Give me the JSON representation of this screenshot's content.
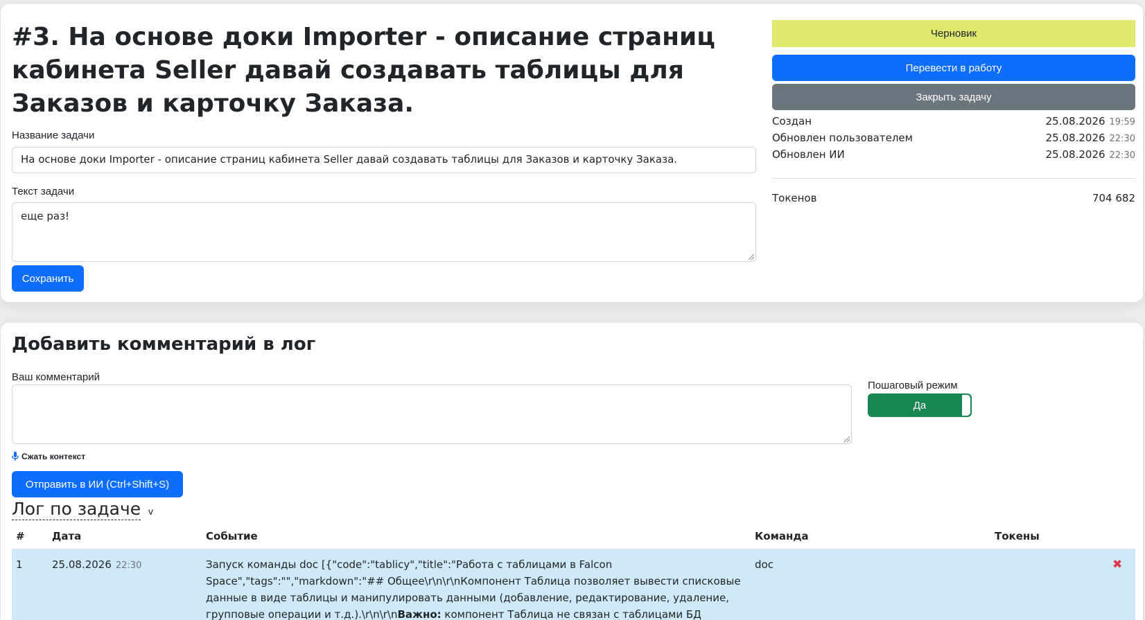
{
  "task": {
    "heading": "#3. На основе доки Importer - описание страниц кабинета Seller давай создавать таблицы для Заказов и карточку Заказа.",
    "name_label": "Название задачи",
    "name_value": "На основе доки Importer - описание страниц кабинета Seller давай создавать таблицы для Заказов и карточку Заказа.",
    "text_label": "Текст задачи",
    "text_value": "еще раз!",
    "save_label": "Сохранить"
  },
  "sidebar": {
    "status": "Черновик",
    "to_work_label": "Перевести в работу",
    "close_label": "Закрыть задачу",
    "created_label": "Создан",
    "created_date": "25.08.2026",
    "created_time": "19:59",
    "updated_user_label": "Обновлен пользователем",
    "updated_user_date": "25.08.2026",
    "updated_user_time": "22:30",
    "updated_ai_label": "Обновлен ИИ",
    "updated_ai_date": "25.08.2026",
    "updated_ai_time": "22:30",
    "tokens_label": "Токенов",
    "tokens_value": "704 682"
  },
  "comment": {
    "title": "Добавить комментарий в лог",
    "comment_label": "Ваш комментарий",
    "comment_value": "",
    "step_mode_label": "Пошаговый режим",
    "step_mode_value": "Да",
    "compress_label": "Сжать контекст",
    "send_label": "Отправить в ИИ (Ctrl+Shift+S)"
  },
  "log": {
    "title": "Лог по задаче",
    "caret": "v",
    "columns": [
      "#",
      "Дата",
      "Событие",
      "Команда",
      "Токены"
    ],
    "rows": [
      {
        "num": "1",
        "date": "25.08.2026",
        "time": "22:30",
        "event_main": "Запуск команды doc [{\"code\":\"tablicy\",\"title\":\"Работа с таблицами в Falcon Space\",\"tags\":\"\",\"markdown\":\"## Общее\\r\\n\\r\\nКомпонент Таблица позволяет вывести списковые данные в виде таблицы и манипулировать данными (добавление, редактирование, удаление, групповые операции и т.д.).\\r\\n\\r\\n",
        "event_bold": "Важно:",
        "event_tail": " компонент Таблица не связан с таблицами БД напрямую.",
        "command": "doc",
        "tokens": "",
        "delete_icon": "✖"
      }
    ]
  },
  "colors": {
    "primary": "#0d6efd",
    "secondary": "#6c757d",
    "status_draft": "#dfe96d",
    "toggle_on": "#198754",
    "row_highlight": "#cfe9f8",
    "danger": "#dc3545"
  }
}
